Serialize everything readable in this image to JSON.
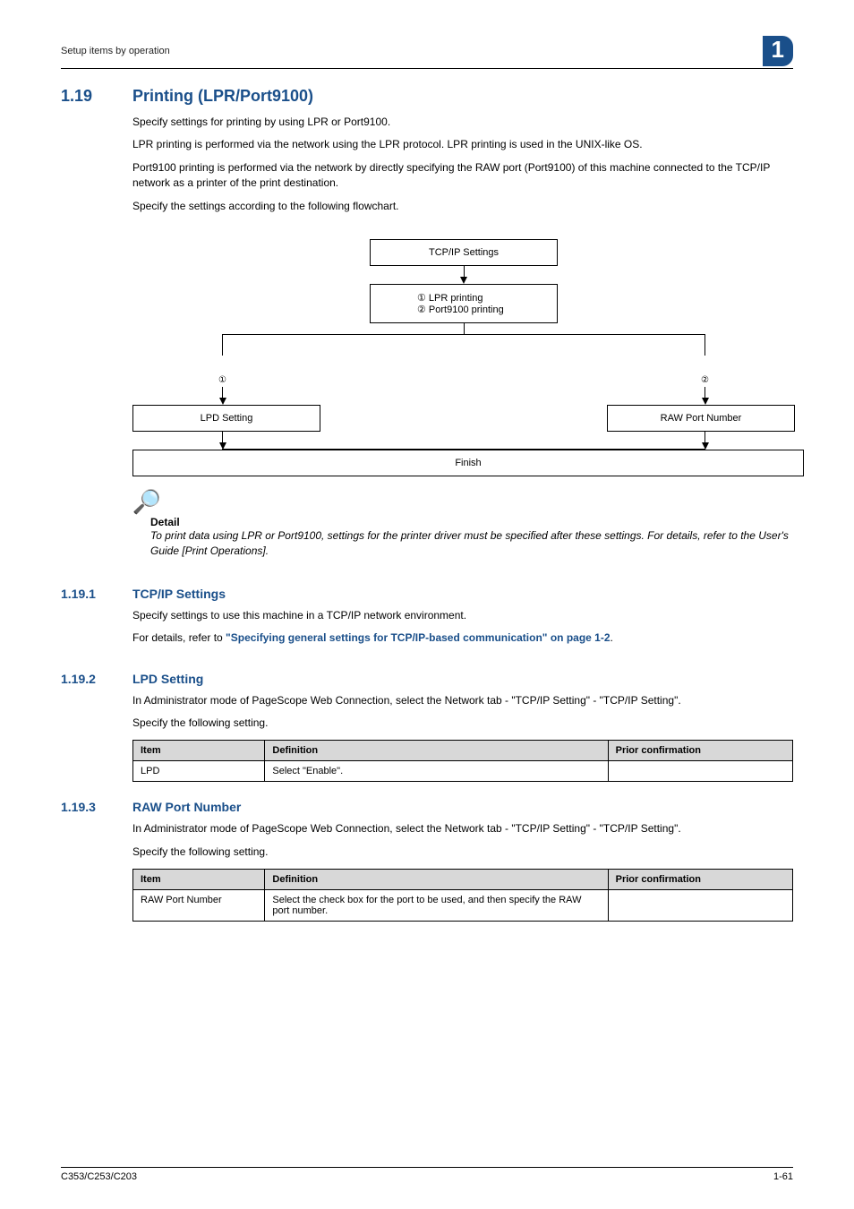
{
  "header": {
    "running": "Setup items by operation",
    "chapter": "1"
  },
  "section": {
    "num": "1.19",
    "title": "Printing (LPR/Port9100)",
    "para1": "Specify settings for printing by using LPR or Port9100.",
    "para2": "LPR printing is performed via the network using the LPR protocol. LPR printing is used in the UNIX-like OS.",
    "para3": "Port9100 printing is performed via the network by directly specifying the RAW port (Port9100) of this machine connected to the TCP/IP network as a printer of the print destination.",
    "para4": "Specify the settings according to the following flowchart."
  },
  "flowchart": {
    "top": "TCP/IP Settings",
    "choice1": "① LPR printing",
    "choice2": "② Port9100 printing",
    "branchL_label": "①",
    "branchR_label": "②",
    "left": "LPD Setting",
    "right": "RAW Port Number",
    "finish": "Finish"
  },
  "detail": {
    "heading": "Detail",
    "text": "To print data using LPR or Port9100, settings for the printer driver must be specified after these settings. For details, refer to the User's Guide [Print Operations]."
  },
  "sub1": {
    "num": "1.19.1",
    "title": "TCP/IP Settings",
    "para": "Specify settings to use this machine in a TCP/IP network environment.",
    "ref_prefix": "For details, refer to ",
    "ref_link": "\"Specifying general settings for TCP/IP-based communication\" on page 1-2",
    "ref_suffix": "."
  },
  "sub2": {
    "num": "1.19.2",
    "title": "LPD Setting",
    "para1": "In Administrator mode of PageScope Web Connection, select the Network tab - \"TCP/IP Setting\" - \"TCP/IP Setting\".",
    "para2": "Specify the following setting.",
    "table": {
      "h_item": "Item",
      "h_def": "Definition",
      "h_prior": "Prior confirmation",
      "r1_item": "LPD",
      "r1_def": "Select \"Enable\".",
      "r1_prior": ""
    }
  },
  "sub3": {
    "num": "1.19.3",
    "title": "RAW Port Number",
    "para1": "In Administrator mode of PageScope Web Connection, select the Network tab - \"TCP/IP Setting\" - \"TCP/IP Setting\".",
    "para2": "Specify the following setting.",
    "table": {
      "h_item": "Item",
      "h_def": "Definition",
      "h_prior": "Prior confirmation",
      "r1_item": "RAW Port Number",
      "r1_def": "Select the check box for the port to be used, and then specify the RAW port number.",
      "r1_prior": ""
    }
  },
  "footer": {
    "left": "C353/C253/C203",
    "right": "1-61"
  }
}
